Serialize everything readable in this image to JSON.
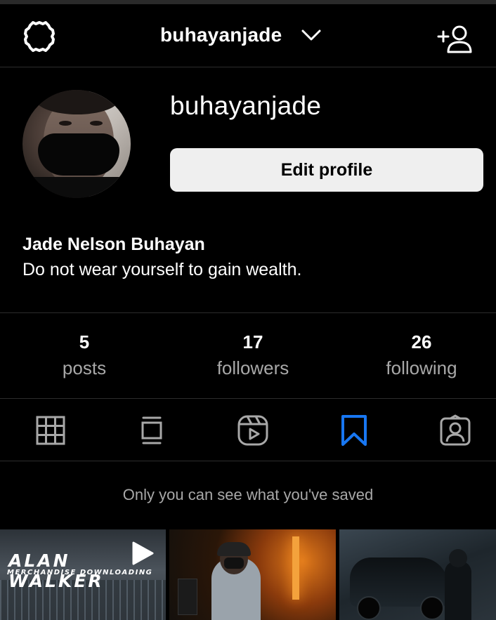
{
  "header": {
    "username": "buhayanjade",
    "icons": [
      "settings-icon",
      "chevron-down-icon",
      "add-user-icon"
    ]
  },
  "profile": {
    "username": "buhayanjade",
    "edit_button": "Edit profile",
    "full_name": "Jade Nelson Buhayan",
    "bio": "Do not wear yourself to gain wealth."
  },
  "stats": [
    {
      "value": "5",
      "label": "posts"
    },
    {
      "value": "17",
      "label": "followers"
    },
    {
      "value": "26",
      "label": "following"
    }
  ],
  "tabs": [
    {
      "icon": "grid-icon",
      "active": false
    },
    {
      "icon": "feed-icon",
      "active": false
    },
    {
      "icon": "reels-icon",
      "active": false
    },
    {
      "icon": "bookmark-icon",
      "active": true
    },
    {
      "icon": "tagged-icon",
      "active": false
    }
  ],
  "saved": {
    "note": "Only you can see what you've saved",
    "thumbnails": [
      {
        "title": "ALAN WALKER",
        "subtitle": "MERCHANDISE DOWNLOADING",
        "has_play_icon": true
      },
      {
        "title": "",
        "subtitle": "",
        "has_play_icon": false
      },
      {
        "title": "",
        "subtitle": "",
        "has_play_icon": false
      }
    ]
  },
  "colors": {
    "background": "#000000",
    "text": "#ffffff",
    "muted": "#a8a8a8",
    "button_bg": "#efefef",
    "accent_active": "#1877f2",
    "divider": "#2c2c2c"
  }
}
